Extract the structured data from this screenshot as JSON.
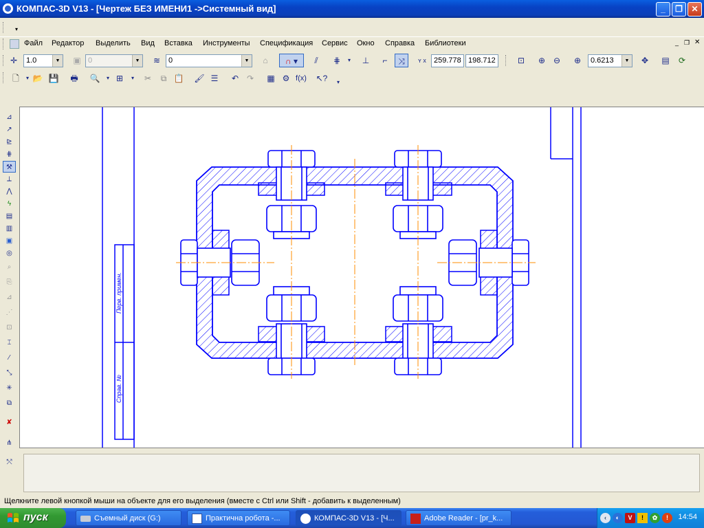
{
  "window": {
    "title": "КОМПАС-3D V13 - [Чертеж БЕЗ ИМЕНИ1 ->Системный вид]"
  },
  "menu": [
    "Файл",
    "Редактор",
    "Выделить",
    "Вид",
    "Вставка",
    "Инструменты",
    "Спецификация",
    "Сервис",
    "Окно",
    "Справка",
    "Библиотеки"
  ],
  "toolbar_current": {
    "step": "1.0",
    "style": "0",
    "layer": "0",
    "coord_x": "259.778",
    "coord_y": "198.712",
    "zoom": "0.6213"
  },
  "drawing": {
    "frame_label_1": "Перв. примен.",
    "frame_label_2": "Справ. №"
  },
  "status": {
    "hint": "Щелкните левой кнопкой мыши на объекте для его выделения (вместе с Ctrl или Shift - добавить к выделенным)"
  },
  "taskbar": {
    "start_label": "пуск",
    "tasks": [
      "Съемный диск (G:)",
      "Практична робота -...",
      "КОМПАС-3D V13 - [Ч...",
      "Adobe Reader - [pr_k..."
    ],
    "clock": "14:54"
  },
  "colors": {
    "drawing_blue": "#0000ff",
    "axis_orange": "#ff8c00",
    "titlebar": "#0842c4"
  }
}
